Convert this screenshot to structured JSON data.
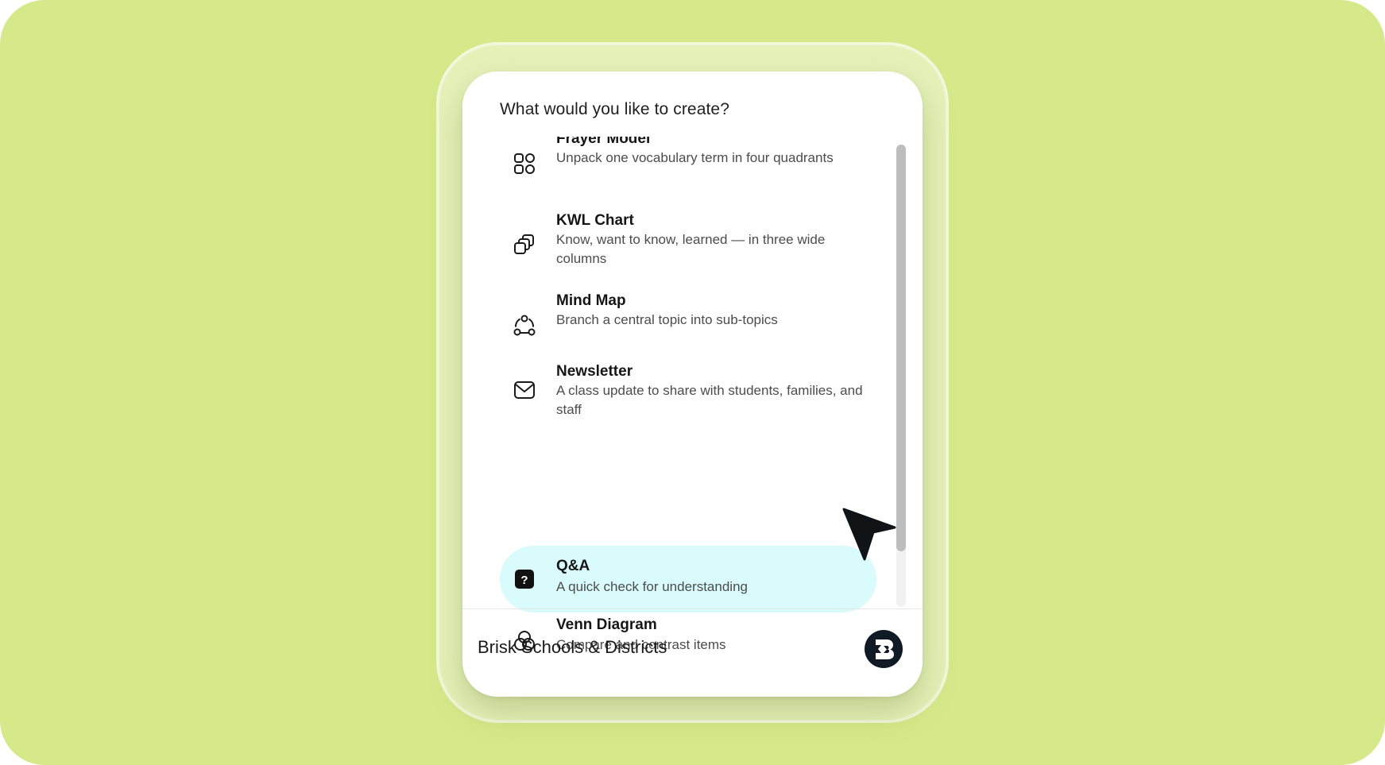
{
  "panel": {
    "prompt": "What would you like to create?",
    "items": [
      {
        "title": "Frayer Model",
        "description": "Unpack one vocabulary term in four quadrants",
        "icon": "grid-icon"
      },
      {
        "title": "KWL Chart",
        "description": "Know, want to know, learned — in three wide columns",
        "icon": "stacked-squares-icon"
      },
      {
        "title": "Mind Map",
        "description": "Branch a central topic into sub-topics",
        "icon": "mind-map-icon"
      },
      {
        "title": "Newsletter",
        "description": "A class update to share with students, families, and staff",
        "icon": "envelope-icon"
      },
      {
        "title": "Q&A",
        "description": "A quick check for understanding",
        "icon": "question-icon",
        "selected": true
      },
      {
        "title": "Venn Diagram",
        "description": "Compare and contrast items",
        "icon": "venn-icon"
      }
    ],
    "footer": {
      "label": "Brisk Schools & Districts",
      "logo": "brisk-logo"
    }
  },
  "colors": {
    "background": "#d5e98b",
    "selected_item": "#d9fbfb",
    "text_primary": "#161616",
    "text_secondary": "#4c4c4c"
  }
}
